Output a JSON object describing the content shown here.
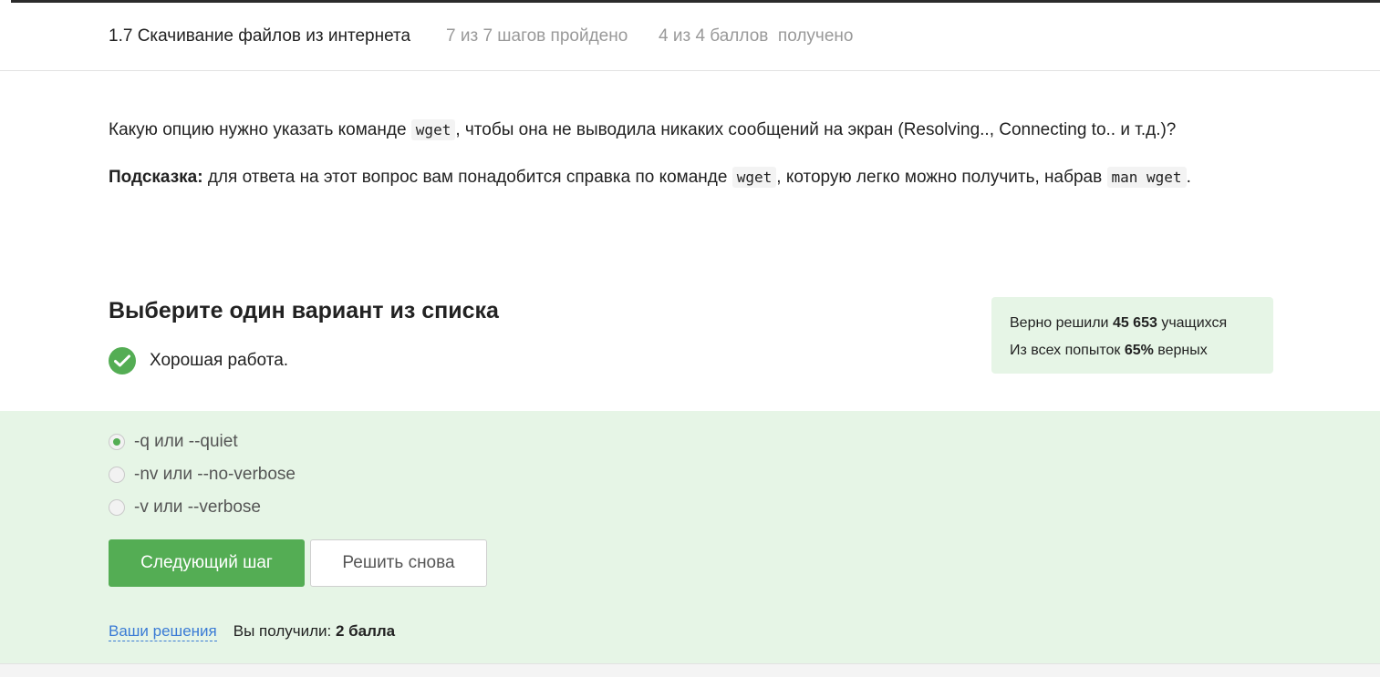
{
  "header": {
    "lesson_title": "1.7 Скачивание файлов из интернета",
    "steps_progress": "7 из 7 шагов пройдено",
    "points_progress": "4 из 4 баллов  получено"
  },
  "question": {
    "part1": "Какую опцию нужно указать команде ",
    "code1": "wget",
    "part2": ", чтобы она не выводила никаких сообщений на экран (Resolving.., Connecting to.. и т.д.)?",
    "hint_label": "Подсказка:",
    "hint_part1": " для ответа на этот вопрос вам понадобится справка по команде ",
    "hint_code1": "wget",
    "hint_part2": ", которую легко можно получить, набрав ",
    "hint_code2": "man wget",
    "hint_part3": "."
  },
  "quiz": {
    "title": "Выберите один вариант из списка",
    "result_text": "Хорошая работа.",
    "check_icon": "checkmark-circle-icon"
  },
  "stats": {
    "solved_prefix": "Верно решили ",
    "solved_count": "45 653",
    "solved_suffix": " учащихся",
    "attempts_prefix": "Из всех попыток ",
    "attempts_percent": "65%",
    "attempts_suffix": " верных"
  },
  "options": [
    {
      "label": "-q или --quiet",
      "selected": true
    },
    {
      "label": "-nv или --no-verbose",
      "selected": false
    },
    {
      "label": "-v или --verbose",
      "selected": false
    }
  ],
  "buttons": {
    "next": "Следующий шаг",
    "retry": "Решить снова"
  },
  "footer": {
    "solutions_link": "Ваши решения",
    "got_prefix": "Вы получили: ",
    "got_value": "2 балла"
  },
  "colors": {
    "accent_green": "#54ad54",
    "panel_green": "#e6f5e6",
    "link_blue": "#3a7bd5"
  }
}
